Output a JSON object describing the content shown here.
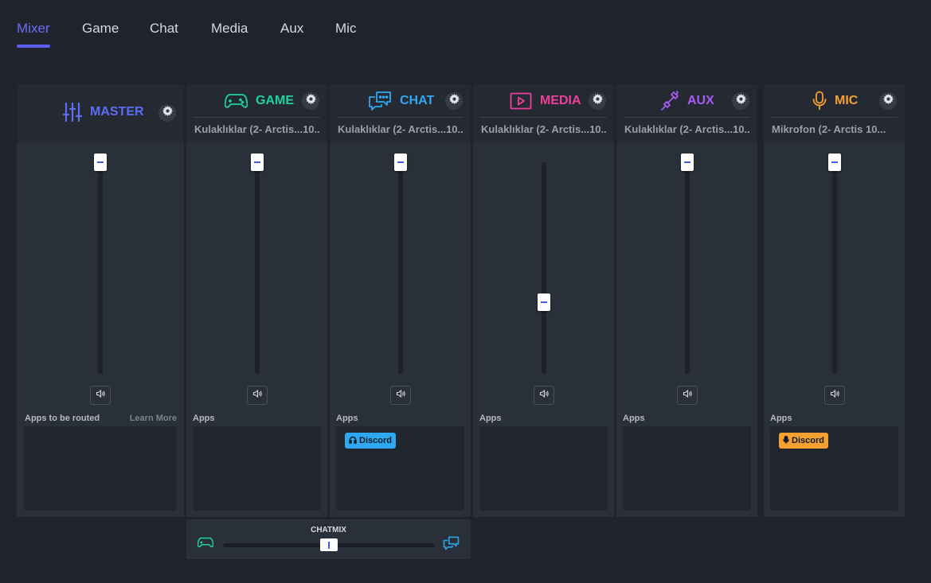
{
  "tabs": [
    "Mixer",
    "Game",
    "Chat",
    "Media",
    "Aux",
    "Mic"
  ],
  "active_tab": "Mixer",
  "colors": {
    "accent": "#5b5ef0",
    "master": "#5b6ef5",
    "game": "#1fd1a4",
    "chat": "#2ea8f0",
    "media": "#ee3f9a",
    "aux": "#a65bf2",
    "mic": "#f5a030"
  },
  "channels": {
    "master": {
      "title": "MASTER",
      "icon": "sliders-icon",
      "volume_percent": 100,
      "apps_label": "Apps to be routed",
      "learn_more": "Learn More"
    },
    "game": {
      "title": "GAME",
      "icon": "gamepad-icon",
      "device": "Kulaklıklar (2- Arctis...10...",
      "volume_percent": 100,
      "apps_label": "Apps"
    },
    "chat": {
      "title": "CHAT",
      "icon": "chat-bubbles-icon",
      "device": "Kulaklıklar (2- Arctis...10...",
      "volume_percent": 100,
      "apps_label": "Apps",
      "app_chip": {
        "label": "Discord",
        "icon": "headphones-icon"
      }
    },
    "media": {
      "title": "MEDIA",
      "icon": "play-icon",
      "device": "Kulaklıklar (2- Arctis...10...",
      "volume_percent": 34,
      "apps_label": "Apps"
    },
    "aux": {
      "title": "AUX",
      "icon": "aux-cable-icon",
      "device": "Kulaklıklar (2- Arctis...10...",
      "volume_percent": 100,
      "apps_label": "Apps"
    },
    "mic": {
      "title": "MIC",
      "icon": "microphone-icon",
      "device": "Mikrofon (2- Arctis  10...",
      "volume_percent": 100,
      "apps_label": "Apps",
      "app_chip": {
        "label": "Discord",
        "icon": "microphone-icon"
      }
    }
  },
  "chatmix": {
    "title": "CHATMIX",
    "balance_percent": 50,
    "left_icon": "gamepad-icon",
    "right_icon": "chat-bubbles-icon"
  }
}
